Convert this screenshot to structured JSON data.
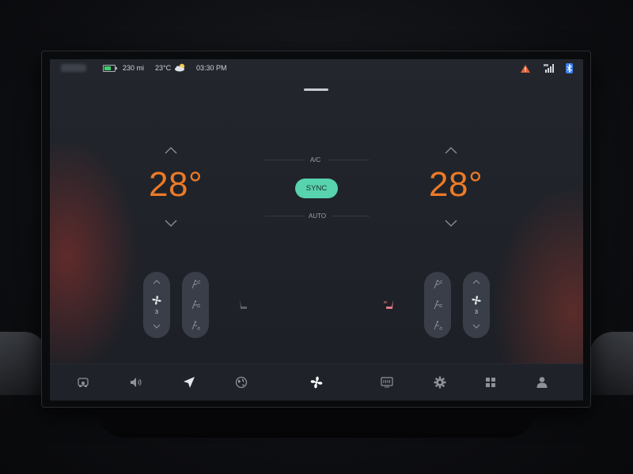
{
  "status": {
    "range": "230 mi",
    "temperature": "23°C",
    "time": "03:30 PM",
    "icons": [
      "battery-icon",
      "partly-cloudy-icon",
      "warning-icon",
      "signal-icon",
      "bluetooth-icon"
    ]
  },
  "climate": {
    "driver_temp": "28°",
    "passenger_temp": "28°",
    "ac_label": "A/C",
    "sync_label": "SYNC",
    "auto_label": "AUTO",
    "driver_fan_speed": "3",
    "passenger_fan_speed": "3"
  },
  "nav": [
    "car-icon",
    "volume-icon",
    "navigation-icon",
    "globe-icon",
    "fan-icon",
    "display-icon",
    "settings-icon",
    "apps-icon",
    "user-icon"
  ],
  "colors": {
    "accent_temp": "#ec7a27",
    "sync": "#57d3ad",
    "battery": "#3ecf6e",
    "warning": "#e4613a",
    "bluetooth": "#3b7ff0",
    "seat_heat": "#e07a86"
  }
}
